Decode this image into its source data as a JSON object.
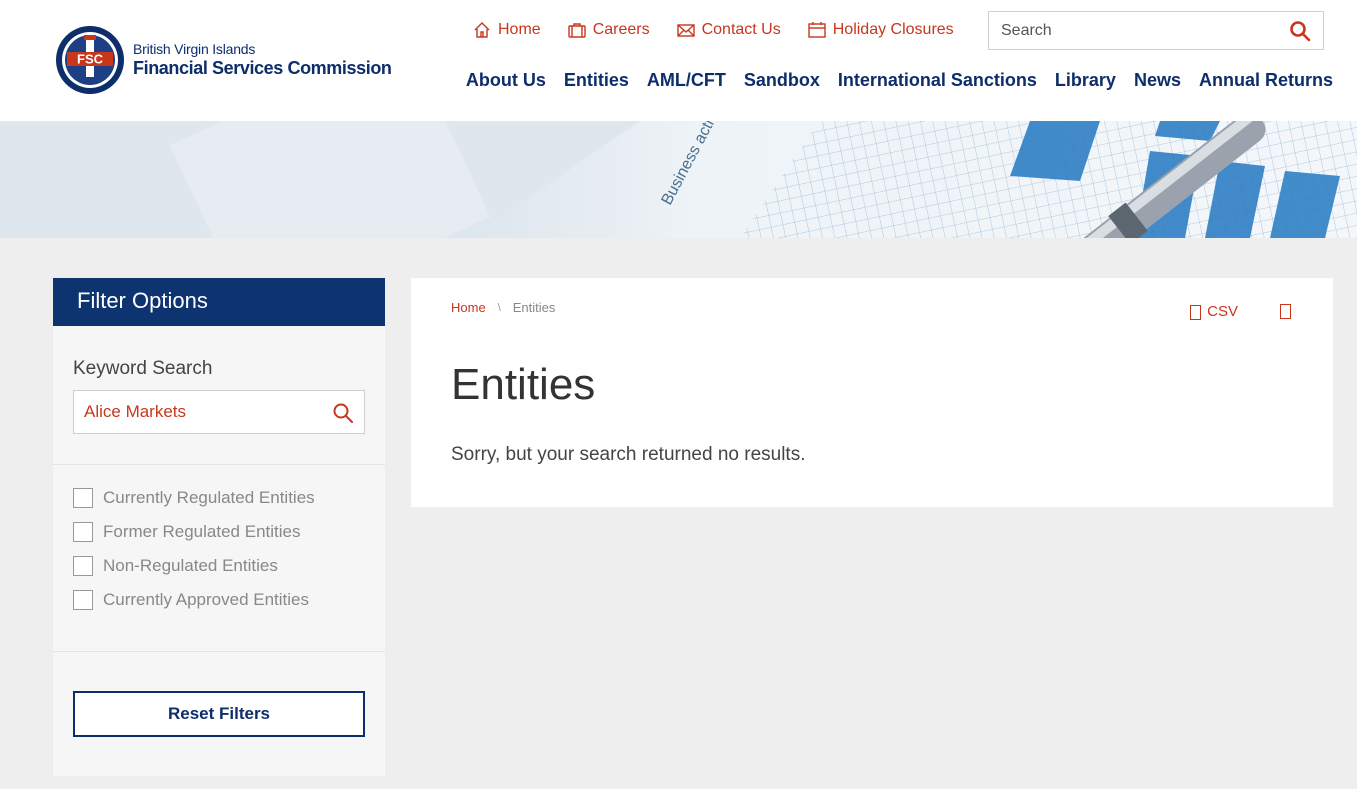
{
  "brand": {
    "line1": "British Virgin Islands",
    "line2": "Financial Services Commission",
    "seal_text": "FSC"
  },
  "utility_nav": [
    {
      "label": "Home",
      "icon": "home-icon"
    },
    {
      "label": "Careers",
      "icon": "briefcase-icon"
    },
    {
      "label": "Contact Us",
      "icon": "envelope-icon"
    },
    {
      "label": "Holiday Closures",
      "icon": "calendar-icon"
    }
  ],
  "search": {
    "placeholder": "Search"
  },
  "main_nav": [
    "About Us",
    "Entities",
    "AML/CFT",
    "Sandbox",
    "International Sanctions",
    "Library",
    "News",
    "Annual Returns"
  ],
  "sidebar": {
    "title": "Filter Options",
    "keyword_label": "Keyword Search",
    "keyword_value": "Alice Markets",
    "filters": [
      {
        "label": "Currently Regulated Entities",
        "checked": false
      },
      {
        "label": "Former Regulated Entities",
        "checked": false
      },
      {
        "label": "Non-Regulated Entities",
        "checked": false
      },
      {
        "label": "Currently Approved Entities",
        "checked": false
      }
    ],
    "reset_label": "Reset Filters"
  },
  "panel": {
    "breadcrumb": {
      "home": "Home",
      "separator": "\\",
      "current": "Entities"
    },
    "csv_label": "CSV",
    "title": "Entities",
    "message": "Sorry, but your search returned no results."
  },
  "colors": {
    "navy": "#0d2d6b",
    "sidebar_header": "#0d3470",
    "accent_red": "#c8361c",
    "background": "#eeeeee"
  }
}
